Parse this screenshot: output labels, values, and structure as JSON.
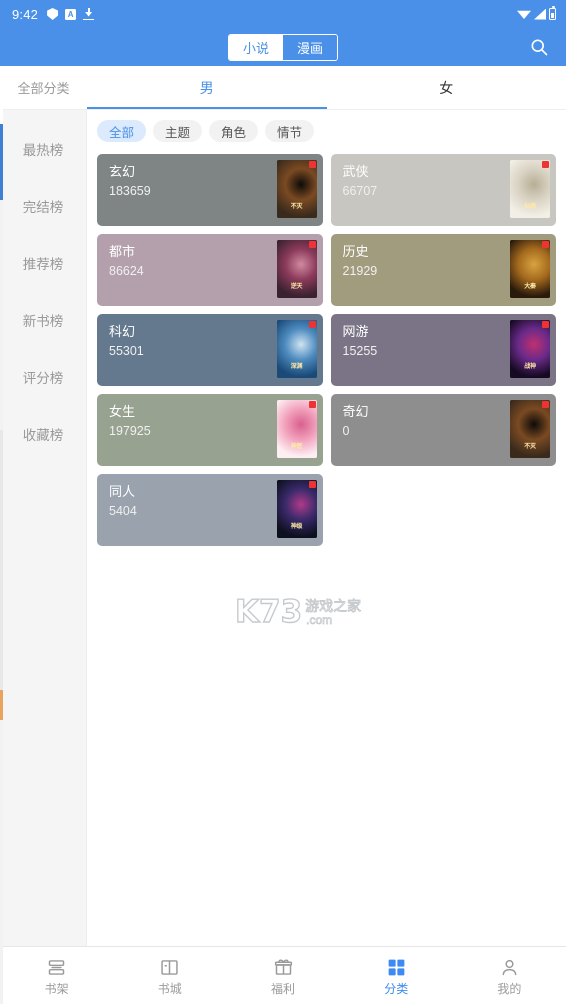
{
  "status_bar": {
    "time": "9:42",
    "left_icons": [
      "shield-icon",
      "a-box-icon",
      "download-icon"
    ],
    "right_icons": [
      "wifi-icon",
      "signal-icon",
      "battery-icon"
    ],
    "a_glyph": "A"
  },
  "app_bar": {
    "segments": [
      {
        "label": "小说",
        "active": true
      },
      {
        "label": "漫画",
        "active": false
      }
    ],
    "search_icon": "search-icon",
    "background_color": "#4a90e8"
  },
  "tabs_row": {
    "all_categories_label": "全部分类",
    "tabs": [
      {
        "label": "男",
        "active": true
      },
      {
        "label": "女",
        "active": false
      }
    ],
    "active_color": "#4a90e8"
  },
  "sidebar": {
    "items": [
      {
        "label": "最热榜"
      },
      {
        "label": "完结榜"
      },
      {
        "label": "推荐榜"
      },
      {
        "label": "新书榜"
      },
      {
        "label": "评分榜"
      },
      {
        "label": "收藏榜"
      }
    ]
  },
  "filters": {
    "chips": [
      {
        "label": "全部",
        "active": true
      },
      {
        "label": "主题",
        "active": false
      },
      {
        "label": "角色",
        "active": false
      },
      {
        "label": "情节",
        "active": false
      }
    ],
    "active_chip_bg": "#dbeafd",
    "active_chip_fg": "#4a90e8"
  },
  "categories": [
    {
      "title": "玄幻",
      "count": "183659",
      "color": "#7f8584",
      "thumb": "dragon-fantasy-cover",
      "thumb_colors": [
        "#3a2a1c",
        "#7a4a22",
        "#0e0b08"
      ],
      "thumb_text": "不灭"
    },
    {
      "title": "武侠",
      "count": "66707",
      "color": "#c7c6c1",
      "thumb": "wuxia-girl-cover",
      "thumb_colors": [
        "#f2efe6",
        "#d8d2c2",
        "#b8ae96"
      ],
      "thumb_text": "仙缘"
    },
    {
      "title": "都市",
      "count": "86624",
      "color": "#b3a0ac",
      "thumb": "urban-woman-cover",
      "thumb_colors": [
        "#3a2230",
        "#8b3a5a",
        "#d08aa0"
      ],
      "thumb_text": "逆天"
    },
    {
      "title": "历史",
      "count": "21929",
      "color": "#a29c7e",
      "thumb": "history-warrior-cover",
      "thumb_colors": [
        "#2a1a0c",
        "#a56a1e",
        "#d8a340"
      ],
      "thumb_text": "大秦"
    },
    {
      "title": "科幻",
      "count": "55301",
      "color": "#65798e",
      "thumb": "scifi-soldier-cover",
      "thumb_colors": [
        "#1a4a78",
        "#4f8cc0",
        "#cfe4f2"
      ],
      "thumb_text": "深渊"
    },
    {
      "title": "网游",
      "count": "15255",
      "color": "#7b7486",
      "thumb": "online-game-cover",
      "thumb_colors": [
        "#160a22",
        "#6a2a8a",
        "#c03070"
      ],
      "thumb_text": "战神"
    },
    {
      "title": "女生",
      "count": "197925",
      "color": "#98a291",
      "thumb": "girl-romance-cover",
      "thumb_colors": [
        "#fdeef2",
        "#f2a0bc",
        "#d8608e"
      ],
      "thumb_text": "神医"
    },
    {
      "title": "奇幻",
      "count": "0",
      "color": "#8e8e8e",
      "thumb": "fantasy-dragon-cover",
      "thumb_colors": [
        "#3a2a1c",
        "#7a4a22",
        "#0e0b08"
      ],
      "thumb_text": "不灭"
    },
    {
      "title": "同人",
      "count": "5404",
      "color": "#9aa2ad",
      "thumb": "doujin-hero-cover",
      "thumb_colors": [
        "#0e1020",
        "#3a2a6a",
        "#b03a8a"
      ],
      "thumb_text": "神级"
    }
  ],
  "watermark": {
    "logo": "K73",
    "cn": "游戏之家",
    "com": ".com"
  },
  "bottom_nav": {
    "items": [
      {
        "label": "书架",
        "icon": "bookshelf-icon",
        "active": false
      },
      {
        "label": "书城",
        "icon": "book-open-icon",
        "active": false
      },
      {
        "label": "福利",
        "icon": "gift-icon",
        "active": false
      },
      {
        "label": "分类",
        "icon": "grid-icon",
        "active": true
      },
      {
        "label": "我的",
        "icon": "person-icon",
        "active": false
      }
    ],
    "active_color": "#3d8bf2",
    "inactive_color": "#9a9a9a"
  }
}
